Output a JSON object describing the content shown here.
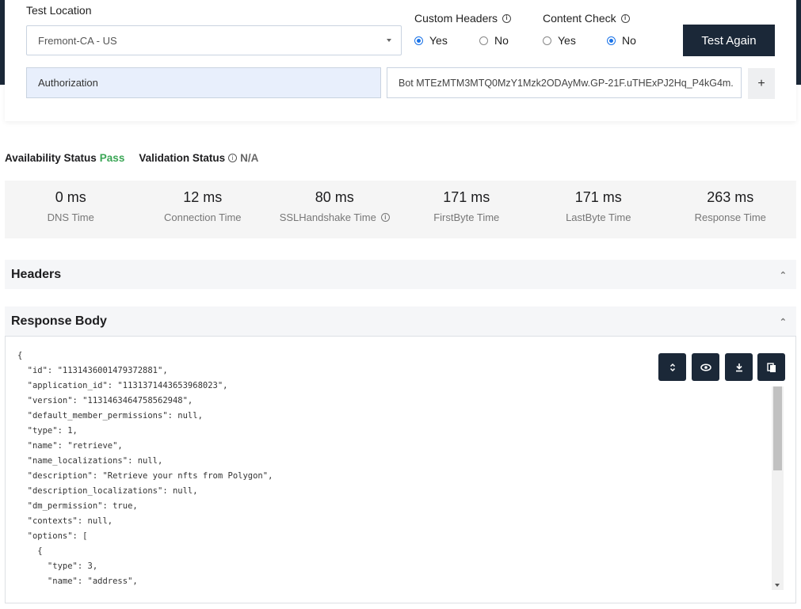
{
  "config": {
    "test_location_label": "Test Location",
    "test_location_value": "Fremont-CA - US",
    "custom_headers": {
      "label": "Custom Headers",
      "options": [
        {
          "label": "Yes",
          "checked": true
        },
        {
          "label": "No",
          "checked": false
        }
      ]
    },
    "content_check": {
      "label": "Content Check",
      "options": [
        {
          "label": "Yes",
          "checked": false
        },
        {
          "label": "No",
          "checked": true
        }
      ]
    },
    "test_again_label": "Test Again",
    "header_key": "Authorization",
    "header_value": "Bot MTEzMTM3MTQ0MzY1Mzk2ODAyMw.GP-21F.uTHExPJ2Hq_P4kG4m.",
    "add_header_label": "+"
  },
  "status": {
    "availability_label": "Availability Status",
    "availability_value": "Pass",
    "validation_label": "Validation Status",
    "validation_value": "N/A"
  },
  "metrics": [
    {
      "value": "0 ms",
      "label": "DNS Time",
      "info": false
    },
    {
      "value": "12 ms",
      "label": "Connection Time",
      "info": false
    },
    {
      "value": "80 ms",
      "label": "SSLHandshake Time",
      "info": true
    },
    {
      "value": "171 ms",
      "label": "FirstByte Time",
      "info": false
    },
    {
      "value": "171 ms",
      "label": "LastByte Time",
      "info": false
    },
    {
      "value": "263 ms",
      "label": "Response Time",
      "info": false
    }
  ],
  "sections": {
    "headers_title": "Headers",
    "response_body_title": "Response Body"
  },
  "response_body": {
    "lines": [
      "{",
      "  \"id\": \"1131436001479372881\",",
      "  \"application_id\": \"1131371443653968023\",",
      "  \"version\": \"1131463464758562948\",",
      "  \"default_member_permissions\": null,",
      "  \"type\": 1,",
      "  \"name\": \"retrieve\",",
      "  \"name_localizations\": null,",
      "  \"description\": \"Retrieve your nfts from Polygon\",",
      "  \"description_localizations\": null,",
      "  \"dm_permission\": true,",
      "  \"contexts\": null,",
      "  \"options\": [",
      "    {",
      "      \"type\": 3,",
      "      \"name\": \"address\","
    ],
    "toolbar": [
      "expand-collapse-icon",
      "eye-icon",
      "download-icon",
      "copy-icon"
    ]
  },
  "colors": {
    "brand_dark": "#1b2838",
    "pass_green": "#3aa655",
    "radio_blue": "#1a73e8"
  }
}
